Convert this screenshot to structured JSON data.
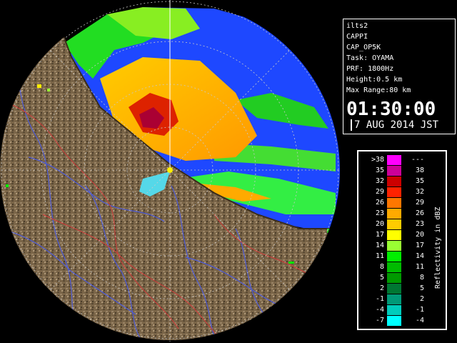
{
  "info": {
    "lines": [
      "ilts2",
      "CAPPI",
      "CAP_OP5K",
      "Task: OYAMA",
      "PRF: 1800Hz",
      "Height:0.5 km",
      "Max Range:80 km"
    ],
    "time": "01:30:00",
    "date": "7 AUG 2014 JST"
  },
  "legend": {
    "title": "Reflectivity in dBZ",
    "rows": [
      {
        "lo": ">38",
        "hi": "---",
        "color": "#ff00ff"
      },
      {
        "lo": "35",
        "hi": "38",
        "color": "#cc0099"
      },
      {
        "lo": "32",
        "hi": "35",
        "color": "#cc0000"
      },
      {
        "lo": "29",
        "hi": "32",
        "color": "#ff2200"
      },
      {
        "lo": "26",
        "hi": "29",
        "color": "#ff7700"
      },
      {
        "lo": "23",
        "hi": "26",
        "color": "#ffaa00"
      },
      {
        "lo": "20",
        "hi": "23",
        "color": "#ffcc00"
      },
      {
        "lo": "17",
        "hi": "20",
        "color": "#ffff00"
      },
      {
        "lo": "14",
        "hi": "17",
        "color": "#99ff33"
      },
      {
        "lo": "11",
        "hi": "14",
        "color": "#00ee00"
      },
      {
        "lo": "8",
        "hi": "11",
        "color": "#00bb00"
      },
      {
        "lo": "5",
        "hi": "8",
        "color": "#009900"
      },
      {
        "lo": "2",
        "hi": "5",
        "color": "#007733"
      },
      {
        "lo": "-1",
        "hi": "2",
        "color": "#009977"
      },
      {
        "lo": "-4",
        "hi": "-1",
        "color": "#00ccbb"
      },
      {
        "lo": "-7",
        "hi": "-4",
        "color": "#00ffff"
      }
    ]
  },
  "colors": {
    "sea_echo": "#1e48ff",
    "land": "#7a6548",
    "radar_background": "#000000"
  }
}
